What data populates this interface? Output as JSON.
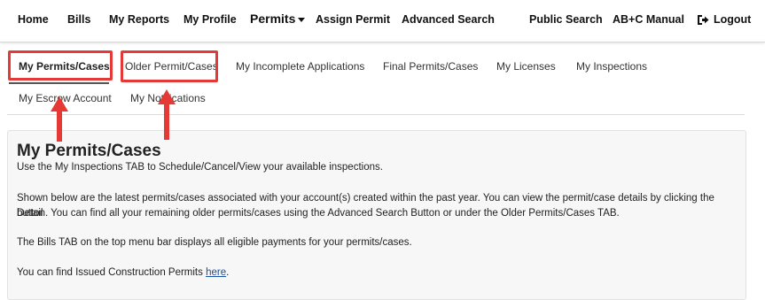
{
  "top_nav": {
    "home": "Home",
    "bills": "Bills",
    "my_reports": "My Reports",
    "my_profile": "My Profile",
    "permits": "Permits",
    "assign_permit": "Assign Permit",
    "advanced_search": "Advanced Search",
    "public_search": "Public Search",
    "abc_manual": "AB+C Manual",
    "logout": "Logout"
  },
  "tabs": {
    "my_permits_cases": "My Permits/Cases",
    "older_permit_cases": "Older Permit/Cases",
    "my_incomplete_applications": "My Incomplete Applications",
    "final_permits_cases": "Final Permits/Cases",
    "my_licenses": "My Licenses",
    "my_inspections": "My Inspections",
    "my_escrow_account": "My Escrow Account",
    "my_notifications": "My Notifications",
    "active": "My Permits/Cases"
  },
  "content": {
    "title": "My Permits/Cases",
    "line1": "Use the My Inspections TAB to Schedule/Cancel/View your available inspections.",
    "para2_line1": "Shown below are the latest permits/cases associated with your account(s) created within the past year. You can view the permit/case details by clicking the Detail",
    "para2_line2": "button. You can find all your remaining older permits/cases using the Advanced Search Button or under the Older Permits/Cases TAB.",
    "para3": "The Bills TAB on the top menu bar displays all eligible payments for your permits/cases.",
    "para4_prefix": "You can find Issued Construction Permits ",
    "para4_link": "here",
    "para4_suffix": "."
  },
  "annotations": {
    "highlight_color": "#e53935"
  },
  "icons": {
    "logout": "logout-icon",
    "permits_dropdown": "caret-down-icon"
  }
}
